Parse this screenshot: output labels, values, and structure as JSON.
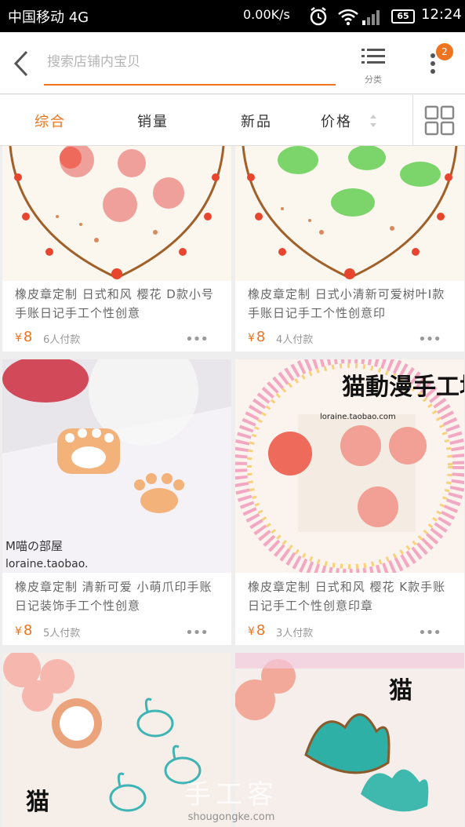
{
  "status_bar": {
    "carrier": "中国移动 4G",
    "net_speed": "0.00K/s",
    "battery": "65",
    "time": "12:24"
  },
  "top_bar": {
    "search_placeholder": "搜索店铺内宝贝",
    "category_label": "分类",
    "notification_count": "2",
    "accent_color": "#f07420"
  },
  "sort_tabs": [
    {
      "label": "综合"
    },
    {
      "label": "销量"
    },
    {
      "label": "新品"
    },
    {
      "label": "价格"
    }
  ],
  "products": [
    {
      "title": "橡皮章定制 日式和风 樱花 D款小号手账日记手工个性创意",
      "price": "8",
      "currency": "¥",
      "sold": "6人付款"
    },
    {
      "title": "橡皮章定制 日式小清新可爱树叶I款手账日记手工个性创意印",
      "price": "8",
      "currency": "¥",
      "sold": "4人付款"
    },
    {
      "title": "橡皮章定制 清新可爱 小萌爪印手账日记装饰手工个性创意",
      "price": "8",
      "currency": "¥",
      "sold": "5人付款"
    },
    {
      "title": "橡皮章定制 日式和风 樱花 K款手账日记手工个性创意印章",
      "price": "8",
      "currency": "¥",
      "sold": "3人付款"
    }
  ],
  "image_texts": {
    "shop_name": "猫動漫手工坊町",
    "shop_url": "loraine.taobao.com",
    "room_label": "M喵の部屋",
    "room_url": "loraine.taobao."
  },
  "watermark": {
    "main": "手工客",
    "site": "shougongke.com"
  }
}
